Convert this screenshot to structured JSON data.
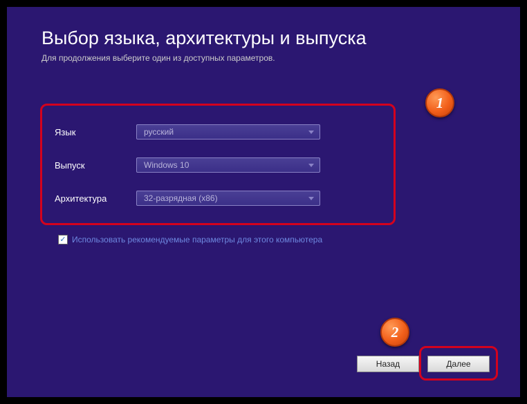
{
  "title": "Выбор языка, архитектуры и выпуска",
  "subtitle": "Для продолжения выберите один из доступных параметров.",
  "fields": {
    "language": {
      "label": "Язык",
      "value": "русский"
    },
    "edition": {
      "label": "Выпуск",
      "value": "Windows 10"
    },
    "architecture": {
      "label": "Архитектура",
      "value": "32-разрядная (x86)"
    }
  },
  "checkbox": {
    "checked": true,
    "label": "Использовать рекомендуемые параметры для этого компьютера"
  },
  "buttons": {
    "back": "Назад",
    "next": "Далее"
  },
  "annotations": {
    "badge1": "1",
    "badge2": "2"
  }
}
